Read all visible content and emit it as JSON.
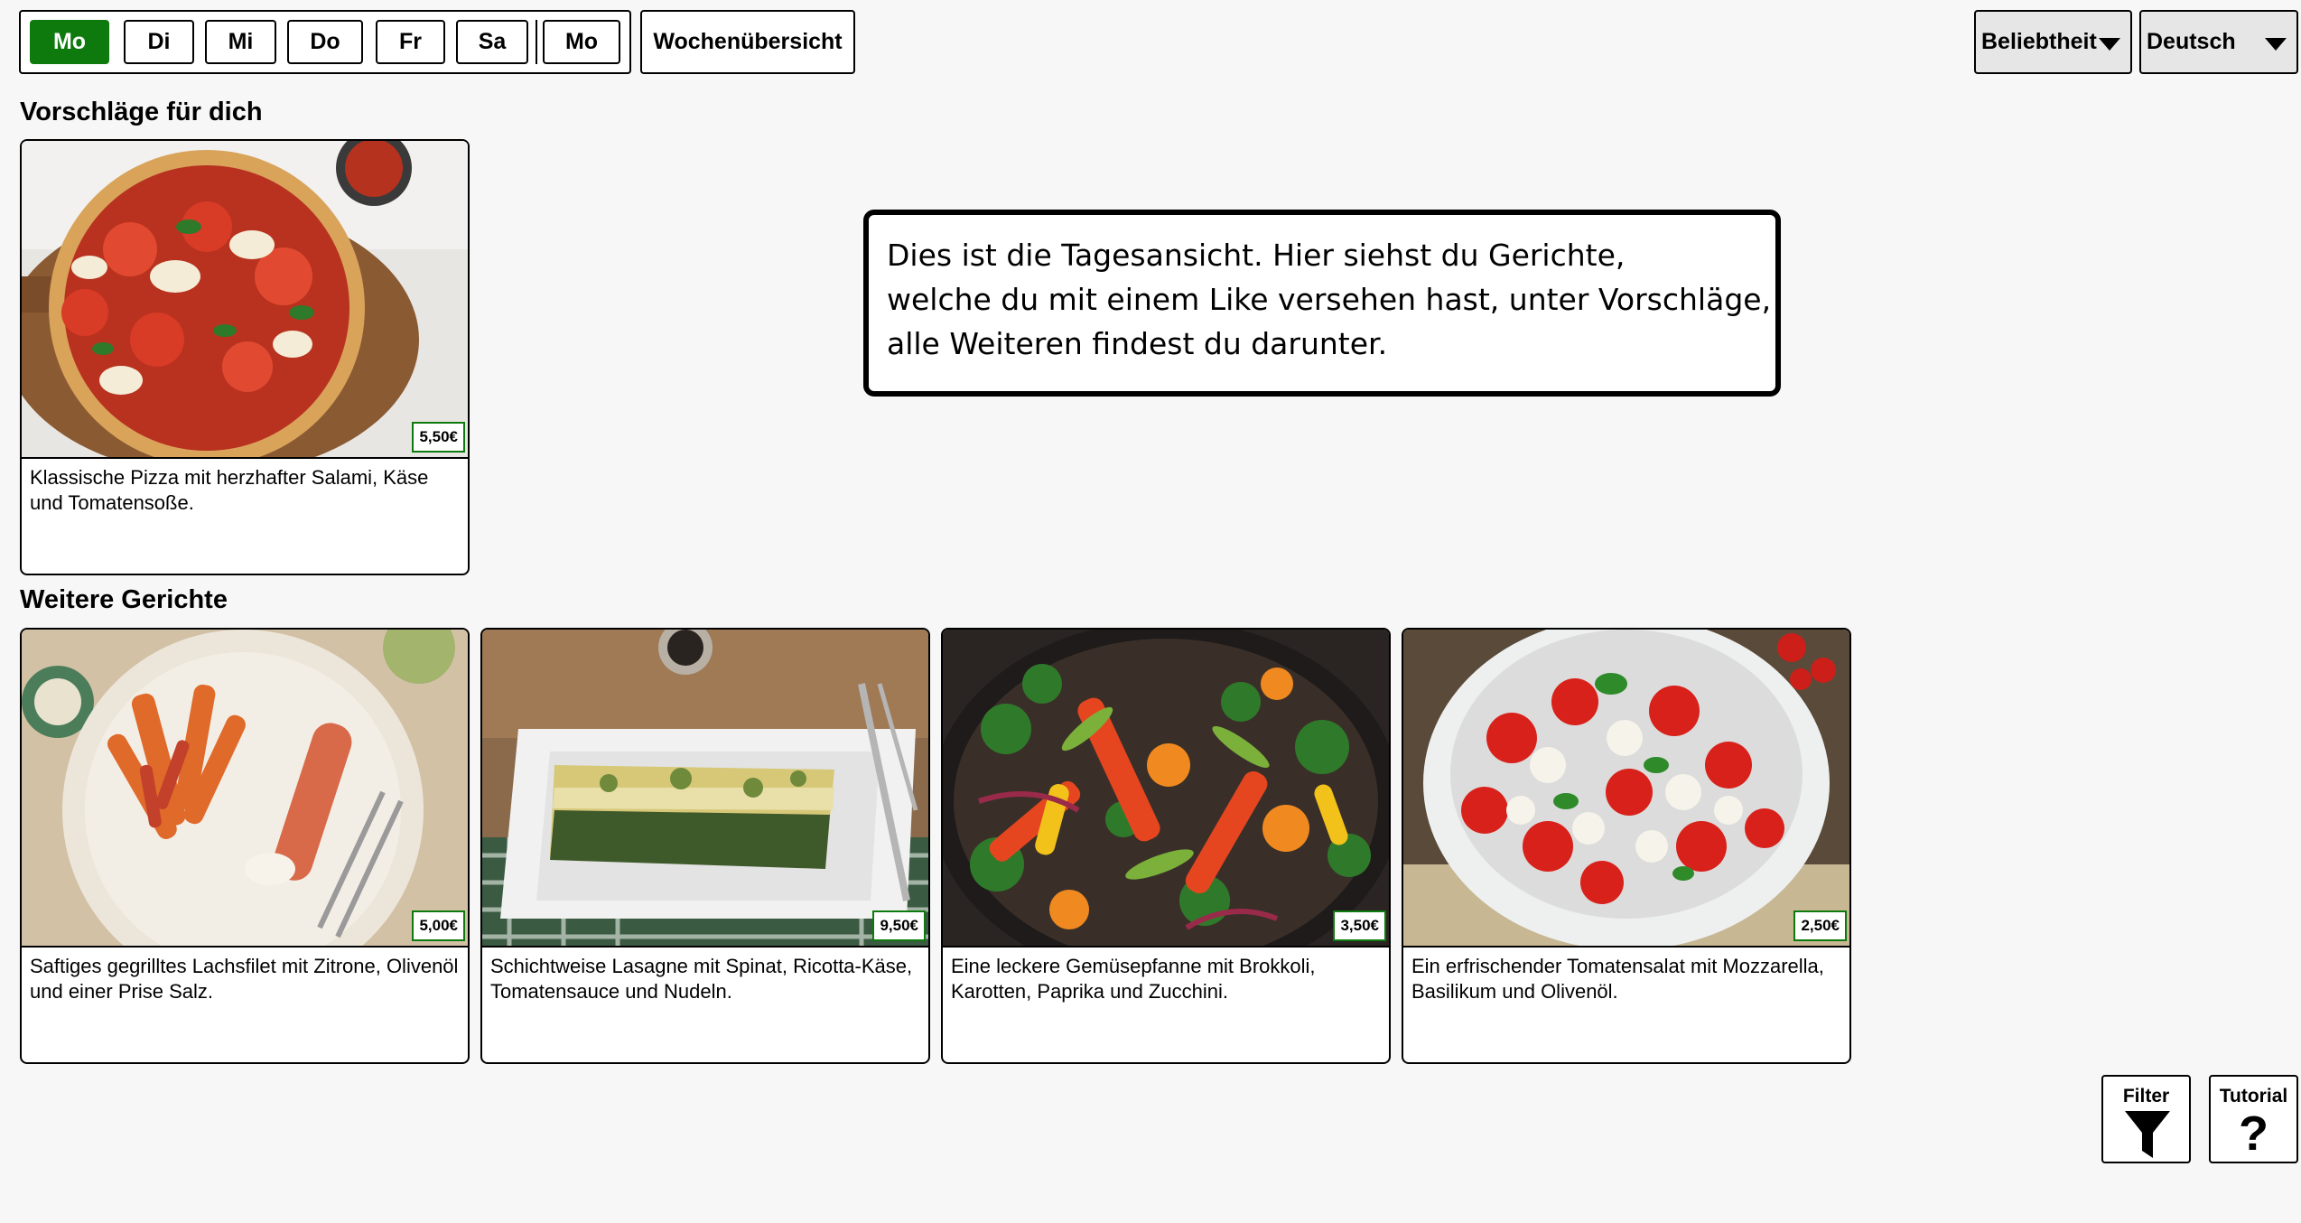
{
  "days": {
    "items": [
      "Mo",
      "Di",
      "Mi",
      "Do",
      "Fr",
      "Sa",
      "Mo"
    ],
    "active": "Mo"
  },
  "week_overview_label": "Wochenübersicht",
  "sort_select": {
    "value": "Beliebtheit"
  },
  "language_select": {
    "value": "Deutsch"
  },
  "suggestions": {
    "title": "Vorschläge für dich",
    "cards": [
      {
        "image": "pizza-image",
        "price": "5,50€",
        "description": "Klassische Pizza mit herzhafter Salami, Käse und Tomatensoße."
      }
    ]
  },
  "more_dishes": {
    "title": "Weitere Gerichte",
    "cards": [
      {
        "image": "salmon-image",
        "price": "5,00€",
        "description": "Saftiges gegrilltes Lachsfilet mit Zitrone, Olivenöl und einer Prise Salz."
      },
      {
        "image": "lasagna-image",
        "price": "9,50€",
        "description": "Schichtweise Lasagne mit Spinat, Ricotta-Käse, Tomatensauce und Nudeln."
      },
      {
        "image": "vegetable-pan-image",
        "price": "3,50€",
        "description": "Eine leckere Gemüsepfanne mit Brokkoli, Karotten, Paprika und Zucchini."
      },
      {
        "image": "tomato-salad-image",
        "price": "2,50€",
        "description": "Ein erfrischender Tomatensalat mit Mozzarella, Basilikum und Olivenöl."
      }
    ]
  },
  "tutorial_tooltip": {
    "lines": [
      "Dies ist die Tagesansicht. Hier siehst du Gerichte,",
      "welche du mit einem Like versehen hast, unter Vorschläge,",
      "alle Weiteren findest du darunter."
    ]
  },
  "filter_button": {
    "label": "Filter",
    "icon": "filter-funnel-icon"
  },
  "tutorial_button": {
    "label": "Tutorial",
    "icon": "question-mark-icon"
  },
  "colors": {
    "accent": "#0e7a0e",
    "background": "#f7f7f7"
  }
}
